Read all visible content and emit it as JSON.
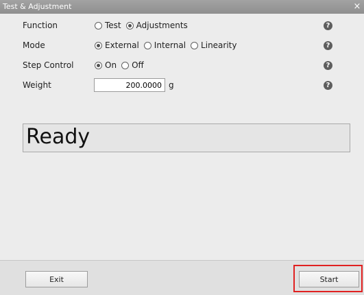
{
  "window": {
    "title": "Test & Adjustment",
    "close_glyph": "×"
  },
  "form": {
    "function": {
      "label": "Function",
      "options": [
        {
          "label": "Test",
          "checked": false
        },
        {
          "label": "Adjustments",
          "checked": true
        }
      ]
    },
    "mode": {
      "label": "Mode",
      "options": [
        {
          "label": "External",
          "checked": true
        },
        {
          "label": "Internal",
          "checked": false
        },
        {
          "label": "Linearity",
          "checked": false
        }
      ]
    },
    "step_control": {
      "label": "Step Control",
      "options": [
        {
          "label": "On",
          "checked": true
        },
        {
          "label": "Off",
          "checked": false
        }
      ]
    },
    "weight": {
      "label": "Weight",
      "value": "200.0000",
      "unit": "g"
    },
    "help_glyph": "?"
  },
  "status": {
    "text": "Ready"
  },
  "footer": {
    "exit_label": "Exit",
    "start_label": "Start",
    "highlight_color": "#e02020"
  }
}
